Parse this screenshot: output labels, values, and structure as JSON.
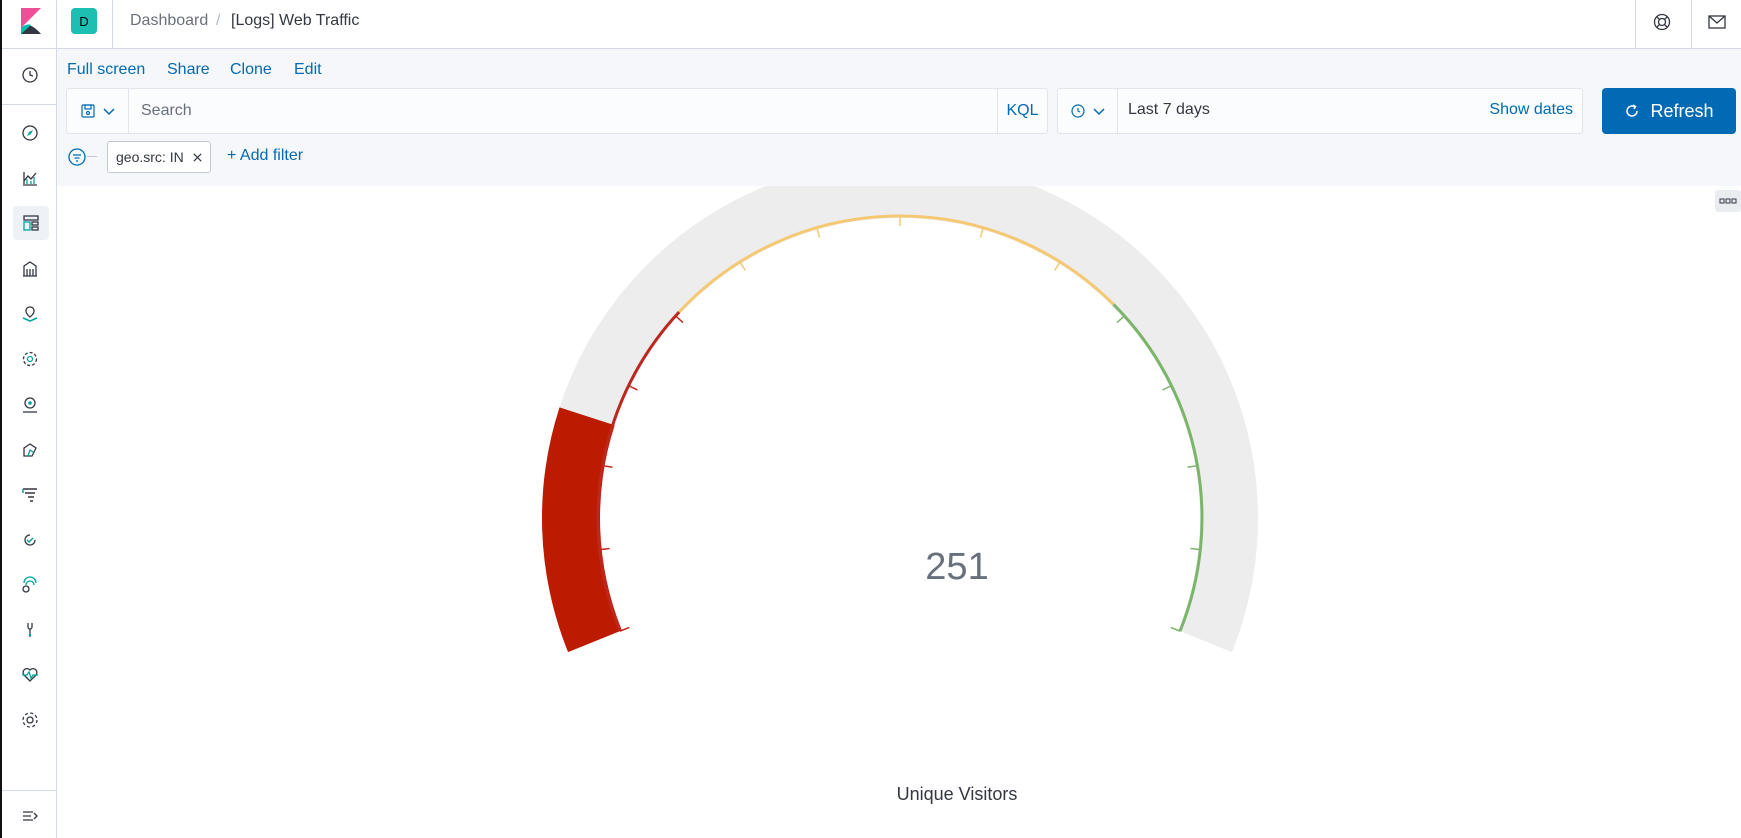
{
  "header": {
    "space_initial": "D",
    "breadcrumb_root": "Dashboard",
    "breadcrumb_separator": "/",
    "breadcrumb_current": "[Logs] Web Traffic"
  },
  "top_menu": {
    "full_screen": "Full screen",
    "share": "Share",
    "clone": "Clone",
    "edit": "Edit"
  },
  "query": {
    "placeholder": "Search",
    "value": "",
    "language": "KQL"
  },
  "date_picker": {
    "range": "Last 7 days",
    "show_dates": "Show dates"
  },
  "refresh_label": "Refresh",
  "filters": {
    "pills": [
      {
        "label": "geo.src: IN"
      }
    ],
    "add_filter": "+ Add filter"
  },
  "gauge": {
    "value": "251",
    "label": "Unique Visitors"
  },
  "chart_data": {
    "type": "gauge",
    "value": 251,
    "label": "Unique Visitors",
    "range_colors": [
      "#bd271e",
      "#f5c873",
      "#7ab56a"
    ],
    "filled_color": "#bd1b00",
    "background_color": "#ededed"
  },
  "colors": {
    "accent": "#006bb4",
    "space": "#1dbfb3"
  },
  "nav_icons": [
    "recent-icon",
    "discover-icon",
    "visualize-icon",
    "dashboard-icon",
    "canvas-icon",
    "maps-icon",
    "ml-icon",
    "infrastructure-icon",
    "logs-icon",
    "apm-icon",
    "uptime-icon",
    "siem-icon",
    "dev-tools-icon",
    "monitoring-icon",
    "management-icon",
    "collapse-icon"
  ]
}
